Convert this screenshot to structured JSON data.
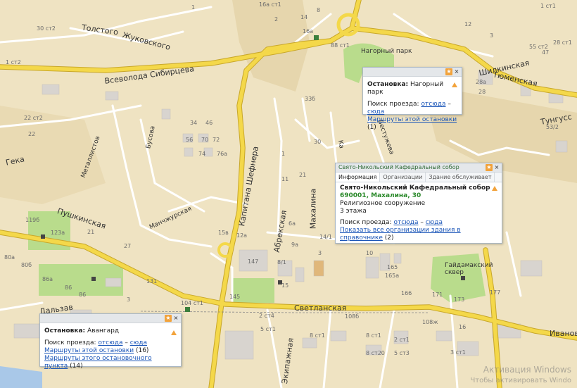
{
  "streets": {
    "tolstogo": "Толстого",
    "zhukovskogo": "Жуковского",
    "vsevolod": "Всеволода Сибирцева",
    "pushkinskaya": "Пушкинская",
    "svetlanskaya": "Светланская",
    "shepherd": "Капитана Шефнера",
    "abrekskaya": "Абрекская",
    "mahalina": "Махалина",
    "shilkinskaya": "Шилкинская",
    "tyumenskaya": "Тюменская",
    "tungusskaya": "Тунгусс",
    "geka": "Гека",
    "metallistov": "Металлистов",
    "mangurskaya": "Манчжурская",
    "ekipazhnaya": "Экипажная",
    "ivanovskaya": "Ивановс",
    "dalzavodskaya": "Дальзав",
    "bestuzheva": "Бестужева",
    "bysova": "Бусова",
    "karl": "Ка",
    "nagorny_park": "Нагорный парк",
    "gaydamak": "Гайдамакский сквер"
  },
  "labels": {
    "l1": "30 ст2",
    "l2": "1",
    "l3": "16a ст1",
    "l4": "8",
    "l5": "1 ст1",
    "l6": "14",
    "l7": "2",
    "l8": "16a",
    "l9": "88 ст1",
    "l10": "12",
    "l11": "3",
    "l12": "55 ст2",
    "l13": "47",
    "l14": "1 ст2",
    "l15": "22 ст2",
    "l16": "22",
    "l17": "34",
    "l18": "46",
    "l19": "56",
    "l20": "70",
    "l21": "72",
    "l22": "76a",
    "l23": "74",
    "l24": "33б",
    "l25": "30",
    "l26": "21",
    "l27": "1",
    "l28": "11",
    "l29": "28a",
    "l30": "28",
    "l31": "53/2",
    "l32": "119б",
    "l33": "123a",
    "l34": "21",
    "l35": "27",
    "l36": "80a",
    "l37": "86",
    "l38": "131",
    "l39": "104 ст1",
    "l40": "147",
    "l41": "8/1",
    "l42": "145",
    "l43": "2 ст4",
    "l44": "5 ст1",
    "l45": "108б",
    "l46": "165",
    "l47": "165a",
    "l48": "166",
    "l49": "171",
    "l50": "173",
    "l51": "177",
    "l52": "16",
    "l53": "8 ст1",
    "l54": "8 ст1",
    "l55": "2 ст1",
    "l56": "108ж",
    "l57": "12a",
    "l58": "15в",
    "l59": "6a",
    "l60": "9a",
    "l61": "14/1",
    "l62": "3",
    "l63": "10",
    "l64": "5 ст3",
    "l65": "8 ст20",
    "l66": "15",
    "l67": "86a",
    "l68": "86",
    "l69": "3",
    "l70": "80б",
    "l71": "3 ст1",
    "l72": "28 ст1"
  },
  "popup_nagorny": {
    "stop_label": "Остановка:",
    "stop_name": "Нагорный парк",
    "route_label": "Поиск проезда:",
    "from": "отсюда",
    "dash": "–",
    "to": "сюда",
    "routes_link": "Маршруты этой остановки",
    "routes_count": "(1)"
  },
  "popup_cathedral": {
    "header": "Свято-Никольский Кафедральный собор",
    "tabs": [
      "Информация",
      "Организации",
      "Здание обслуживает"
    ],
    "name": "Свято-Никольский Кафедральный собор",
    "address": "690001, Махалина, 30",
    "type": "Религиозное сооружение",
    "floors": "3 этажа",
    "route_label": "Поиск проезда:",
    "from": "отсюда",
    "dash": "–",
    "to": "сюда",
    "orgs_link": "Показать все организации здания в справочнике",
    "orgs_count": "(2)"
  },
  "popup_avangard": {
    "stop_label": "Остановка:",
    "stop_name": "Авангард",
    "route_label": "Поиск проезда:",
    "from": "отсюда",
    "dash": "–",
    "to": "сюда",
    "routes_link": "Маршруты этой остановки",
    "routes_count": "(16)",
    "point_link": "Маршруты этого остановочного пункта",
    "point_count": "(14)"
  },
  "watermark": {
    "line1": "Активация Windows",
    "line2": "Чтобы активировать Windo"
  },
  "colors": {
    "background": "#efe3c2",
    "main_road": "#f4d84a",
    "minor_road": "#ffffff",
    "park": "#b9dc8c",
    "building": "#d8d4cf",
    "link": "#1a55b8",
    "warning": "#f2a33c"
  }
}
